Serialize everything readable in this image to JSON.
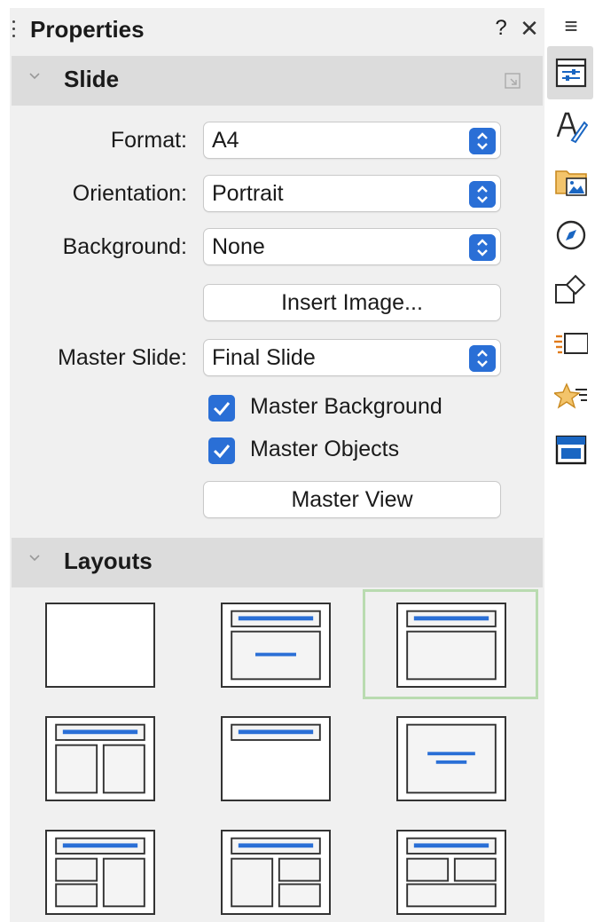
{
  "panel": {
    "title": "Properties",
    "help_label": "?",
    "close_label": "✕"
  },
  "slide_section": {
    "heading": "Slide",
    "format_label": "Format:",
    "format_value": "A4",
    "orientation_label": "Orientation:",
    "orientation_value": "Portrait",
    "background_label": "Background:",
    "background_value": "None",
    "insert_image_label": "Insert Image...",
    "master_slide_label": "Master Slide:",
    "master_slide_value": "Final Slide",
    "master_background_label": "Master Background",
    "master_background_checked": true,
    "master_objects_label": "Master Objects",
    "master_objects_checked": true,
    "master_view_label": "Master View"
  },
  "layouts_section": {
    "heading": "Layouts",
    "selected_index": 2,
    "items": [
      "blank-slide",
      "title-content",
      "title-content-box",
      "title-two-content",
      "title-only",
      "centered-text",
      "title-content-two-content",
      "title-two-content-content",
      "title-two-content-over-content"
    ]
  },
  "sidebar": {
    "menu_label": "≡",
    "tabs": [
      "properties-icon",
      "styles-icon",
      "gallery-icon",
      "navigator-icon",
      "shapes-icon",
      "slide-transition-icon",
      "animation-icon",
      "master-slides-icon"
    ],
    "active_tab": "properties-icon"
  },
  "colors": {
    "accent": "#2a6fd6",
    "selection": "#b9dbb0",
    "panel_bg": "#f0f0f0",
    "section_bg": "#dcdcdc"
  }
}
